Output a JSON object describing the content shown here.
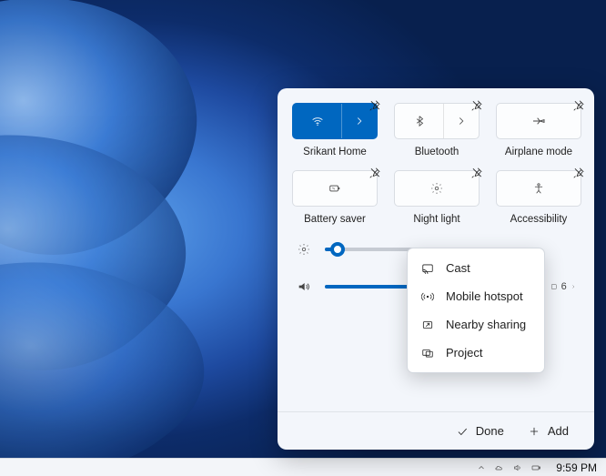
{
  "accent_color": "#0067c0",
  "tiles": [
    {
      "id": "wifi",
      "label": "Srikant Home",
      "active": true,
      "expandable": true
    },
    {
      "id": "bluetooth",
      "label": "Bluetooth",
      "active": false,
      "expandable": true
    },
    {
      "id": "airplane",
      "label": "Airplane mode",
      "active": false,
      "expandable": false
    },
    {
      "id": "battery-saver",
      "label": "Battery saver",
      "active": false,
      "expandable": false
    },
    {
      "id": "night-light",
      "label": "Night light",
      "active": false,
      "expandable": false
    },
    {
      "id": "accessibility",
      "label": "Accessibility",
      "active": false,
      "expandable": false
    }
  ],
  "sliders": {
    "brightness": {
      "value_pct": 6
    },
    "volume": {
      "value_pct": 68,
      "device_badge": "6"
    }
  },
  "popup": {
    "items": [
      {
        "id": "cast",
        "label": "Cast"
      },
      {
        "id": "mobile-hotspot",
        "label": "Mobile hotspot"
      },
      {
        "id": "nearby-sharing",
        "label": "Nearby sharing"
      },
      {
        "id": "project",
        "label": "Project"
      }
    ]
  },
  "footer": {
    "done_label": "Done",
    "add_label": "Add"
  },
  "taskbar": {
    "clock": "9:59 PM"
  }
}
